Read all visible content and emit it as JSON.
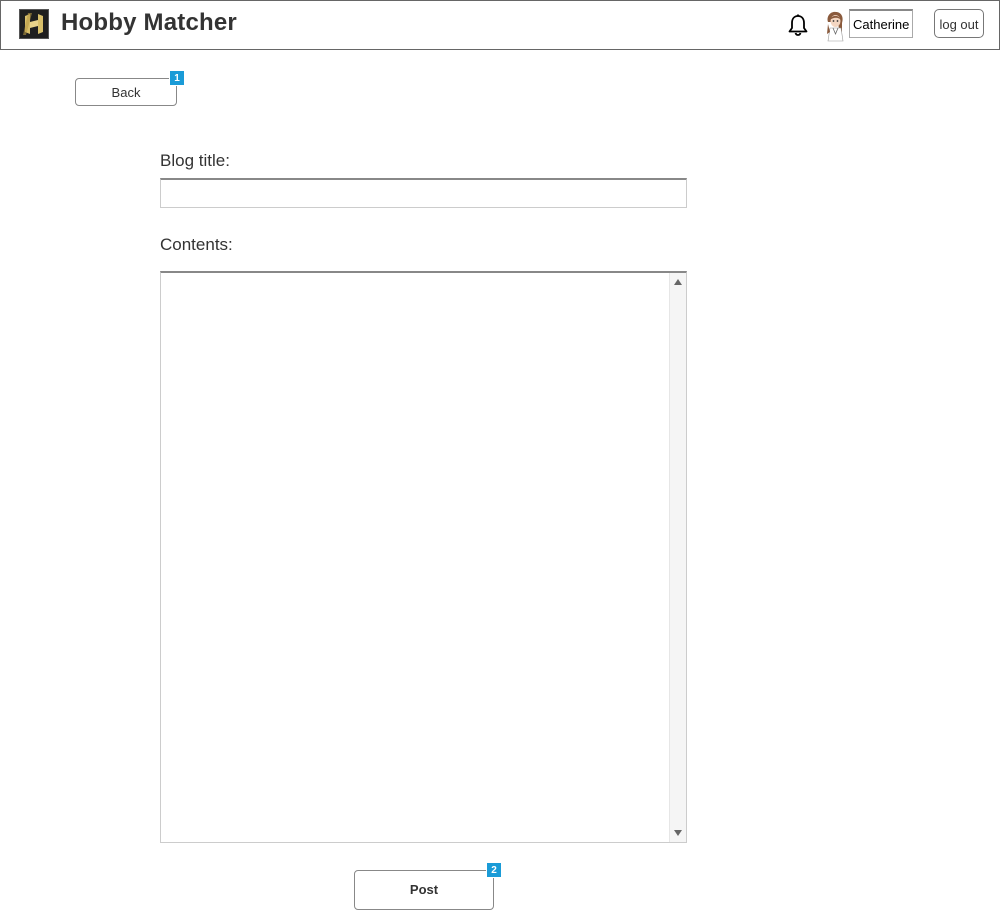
{
  "header": {
    "app_title": "Hobby Matcher",
    "logo_icon": "hobby-matcher-logo",
    "notification_icon": "bell-icon",
    "avatar_icon": "user-avatar",
    "username": "Catherine",
    "logout_label": "log out"
  },
  "nav": {
    "back_label": "Back",
    "back_badge": "1"
  },
  "form": {
    "title_label": "Blog title:",
    "title_value": "",
    "contents_label": "Contents:",
    "contents_value": "",
    "post_label": "Post",
    "post_badge": "2"
  },
  "colors": {
    "badge": "#1a9bd7",
    "text": "#333333",
    "border": "#888888"
  }
}
